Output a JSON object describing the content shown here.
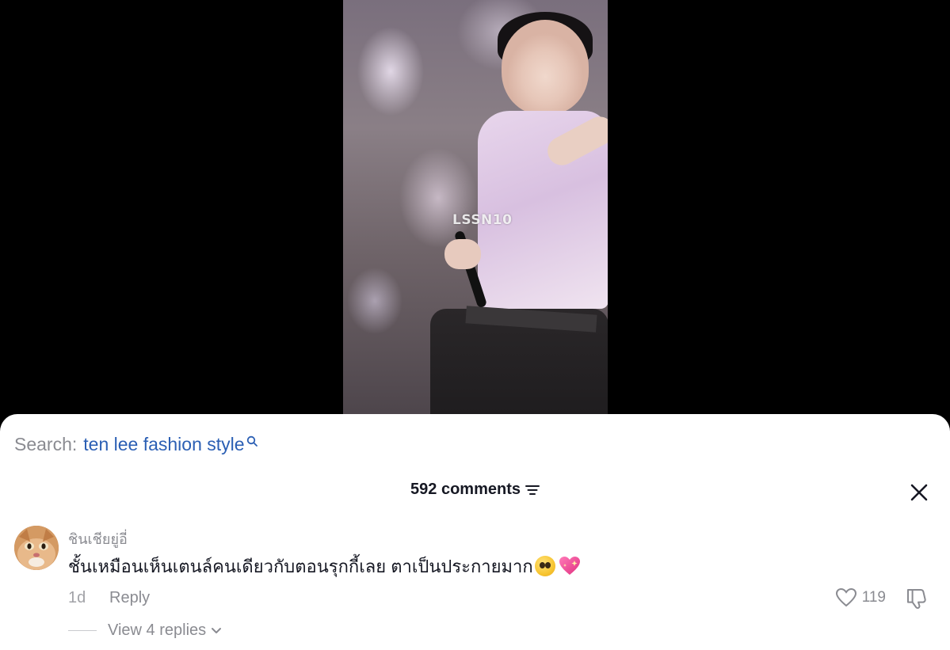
{
  "video": {
    "watermark": "LSSN10"
  },
  "search": {
    "label": "Search:",
    "query": "ten lee fashion style"
  },
  "comments": {
    "count_label": "592 comments",
    "items": [
      {
        "username": "ชินเชียยู่อี่",
        "text": "ชั้นเหมือนเห็นเตนล์คนเดียวกับตอนรุกกี้เลย ตาเป็นประกายมาก",
        "emojis": [
          "pleading-face",
          "sparkling-heart"
        ],
        "time": "1d",
        "reply_label": "Reply",
        "likes": "119",
        "view_replies_label": "View 4 replies"
      }
    ]
  },
  "colors": {
    "search_query": "#2b5fb4",
    "muted_text": "#8a8b91",
    "primary_text": "#161823",
    "sheet_bg": "#ffffff",
    "backdrop": "#000000"
  },
  "icons": [
    "search-icon",
    "filter-icon",
    "close-icon",
    "heart-icon",
    "dislike-icon",
    "chevron-down-icon"
  ]
}
